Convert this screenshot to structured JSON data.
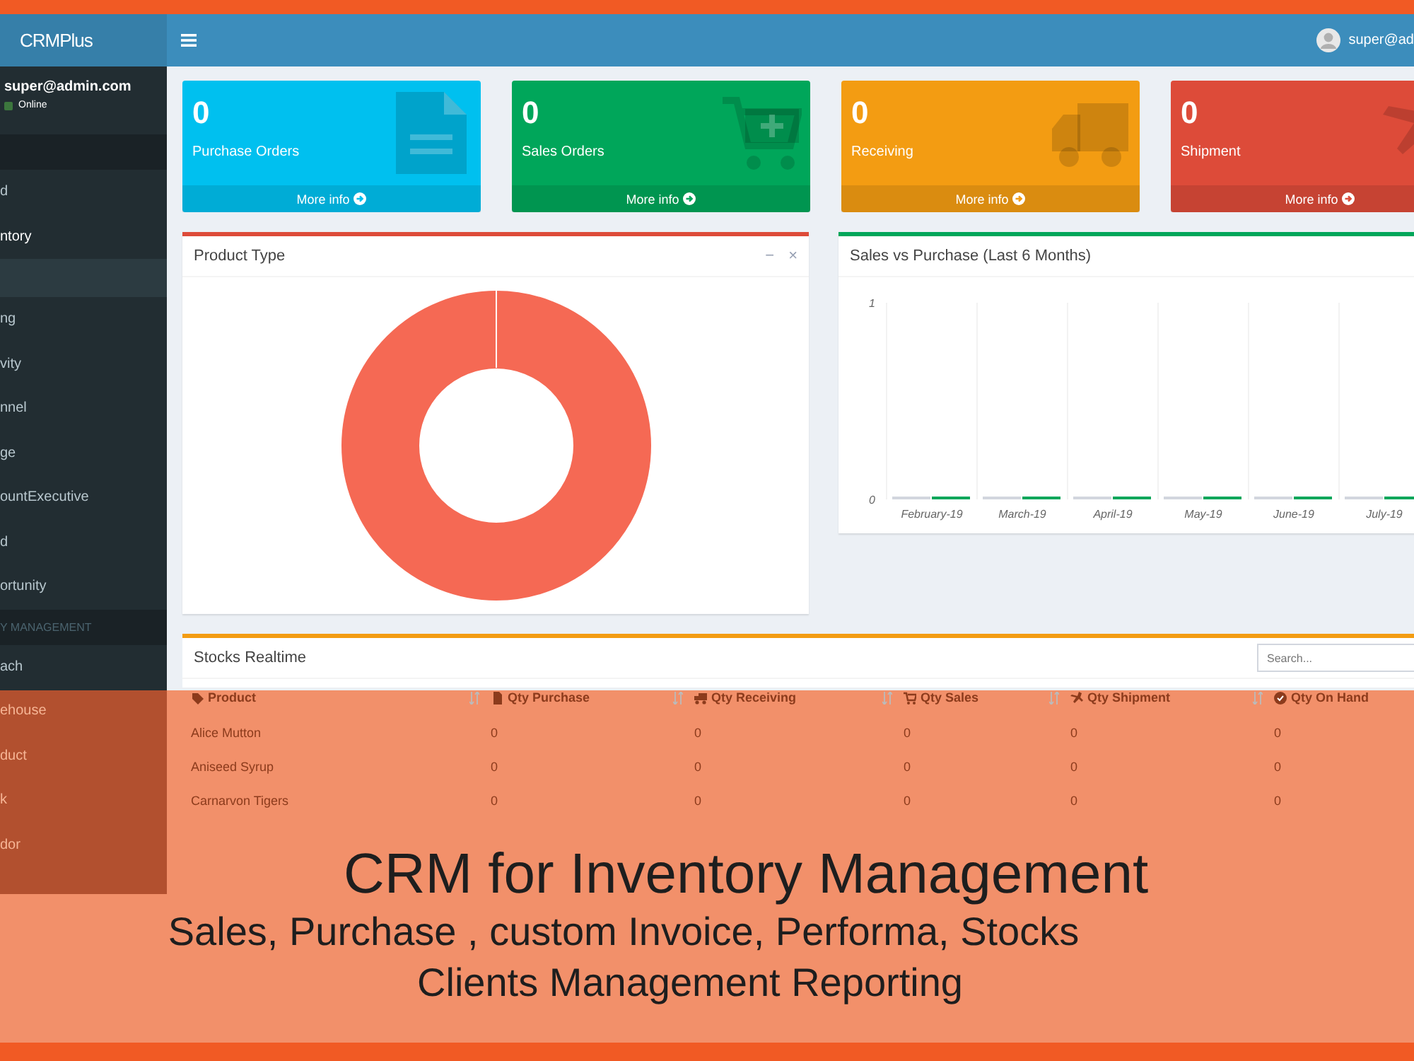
{
  "navbar": {
    "logo": "CRMPlus",
    "user": "super@ad"
  },
  "sidebar": {
    "user": {
      "email": "super@admin.com",
      "status": "Online"
    },
    "items": [
      {
        "kind": "header"
      },
      {
        "kind": "item",
        "label": "d",
        "selected": false
      },
      {
        "kind": "item",
        "label": "ntory",
        "selected": true
      },
      {
        "kind": "spacer"
      },
      {
        "kind": "item",
        "label": "ng",
        "selected": false
      },
      {
        "kind": "item",
        "label": "vity",
        "selected": false
      },
      {
        "kind": "item",
        "label": "nnel",
        "selected": false
      },
      {
        "kind": "item",
        "label": "ge",
        "selected": false
      },
      {
        "kind": "item",
        "label": "ountExecutive",
        "selected": false
      },
      {
        "kind": "item",
        "label": "d",
        "selected": false
      },
      {
        "kind": "item",
        "label": "ortunity",
        "selected": false
      },
      {
        "kind": "header",
        "label": "Y MANAGEMENT"
      },
      {
        "kind": "item",
        "label": "ach",
        "selected": false
      },
      {
        "kind": "item",
        "label": "ehouse",
        "selected": false
      },
      {
        "kind": "item",
        "label": "duct",
        "selected": false
      },
      {
        "kind": "item",
        "label": "k",
        "selected": false
      },
      {
        "kind": "item",
        "label": "dor",
        "selected": false
      }
    ]
  },
  "info_boxes": [
    {
      "count": "0",
      "label": "Purchase Orders",
      "link": "More info",
      "color": "#00c0ef",
      "kind": "document"
    },
    {
      "count": "0",
      "label": "Sales Orders",
      "link": "More info",
      "color": "#00a65a",
      "kind": "cart"
    },
    {
      "count": "0",
      "label": "Receiving",
      "link": "More info",
      "color": "#f39c12",
      "kind": "truck"
    },
    {
      "count": "0",
      "label": "Shipment",
      "link": "More info",
      "color": "#dd4b39",
      "kind": "plane"
    }
  ],
  "product_type_panel": {
    "title": "Product Type",
    "tools": [
      "−",
      "×"
    ]
  },
  "sales_panel": {
    "title": "Sales vs Purchase (Last 6 Months)",
    "chart_data": {
      "type": "bar",
      "categories": [
        "February-19",
        "March-19",
        "April-19",
        "May-19",
        "June-19",
        "July-19"
      ],
      "series": [
        {
          "color": "#d2d6de",
          "values": [
            0,
            0,
            0,
            0,
            0,
            0
          ]
        },
        {
          "color": "#00a65a",
          "values": [
            0,
            0,
            0,
            0,
            0,
            0
          ]
        }
      ],
      "ylim": [
        0,
        1
      ],
      "yticks": [
        0,
        1
      ]
    }
  },
  "stocks_panel": {
    "title": "Stocks Realtime",
    "search": {
      "placeholder": "Search..."
    },
    "columns": [
      {
        "label": "Product",
        "kind": "tag"
      },
      {
        "label": "Qty Purchase",
        "kind": "file"
      },
      {
        "label": "Qty Receiving",
        "kind": "truck"
      },
      {
        "label": "Qty Sales",
        "kind": "cart"
      },
      {
        "label": "Qty Shipment",
        "kind": "plane"
      },
      {
        "label": "Qty On Hand",
        "kind": "check"
      }
    ],
    "rows": [
      [
        "Alice Mutton",
        "0",
        "0",
        "0",
        "0",
        "0"
      ],
      [
        "Aniseed Syrup",
        "0",
        "0",
        "0",
        "0",
        "0"
      ],
      [
        "Carnarvon Tigers",
        "0",
        "0",
        "0",
        "0",
        "0"
      ]
    ]
  },
  "banner": {
    "title": "CRM for Inventory Management",
    "lines": [
      "Sales, Purchase , custom Invoice, Performa, Stocks",
      "Clients Management Reporting"
    ]
  }
}
